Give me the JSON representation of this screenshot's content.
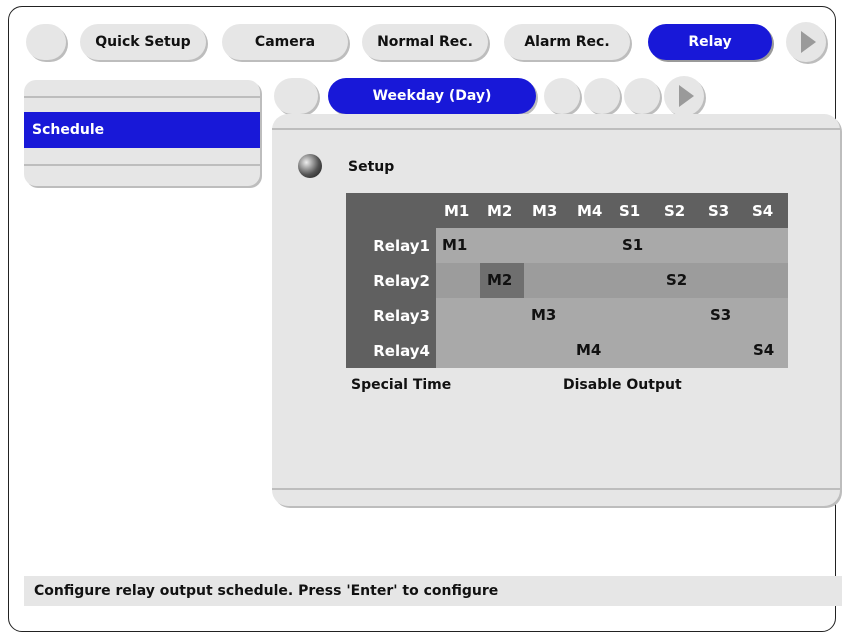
{
  "top_tabs": {
    "quick_setup": "Quick Setup",
    "camera": "Camera",
    "normal_rec": "Normal Rec.",
    "alarm_rec": "Alarm Rec.",
    "relay": "Relay"
  },
  "sidebar": {
    "items": [
      {
        "label": "Schedule",
        "selected": true
      }
    ]
  },
  "sub_tabs": {
    "active": "Weekday (Day)"
  },
  "main": {
    "section_label": "Setup",
    "grid": {
      "columns": [
        "M1",
        "M2",
        "M3",
        "M4",
        "S1",
        "S2",
        "S3",
        "S4"
      ],
      "rows": [
        {
          "label": "Relay1",
          "m": "M1",
          "s": "S1"
        },
        {
          "label": "Relay2",
          "m": "M2",
          "s": "S2"
        },
        {
          "label": "Relay3",
          "m": "M3",
          "s": "S3"
        },
        {
          "label": "Relay4",
          "m": "M4",
          "s": "S4"
        }
      ]
    },
    "special_time": "Special Time",
    "disable_output": "Disable Output"
  },
  "status_bar": {
    "text": "Configure relay output schedule. Press 'Enter' to configure"
  },
  "colors": {
    "accent": "#1818d8",
    "panel": "#e6e6e6",
    "grid_dark": "#606060",
    "grid_light": "#a9a9a9"
  }
}
